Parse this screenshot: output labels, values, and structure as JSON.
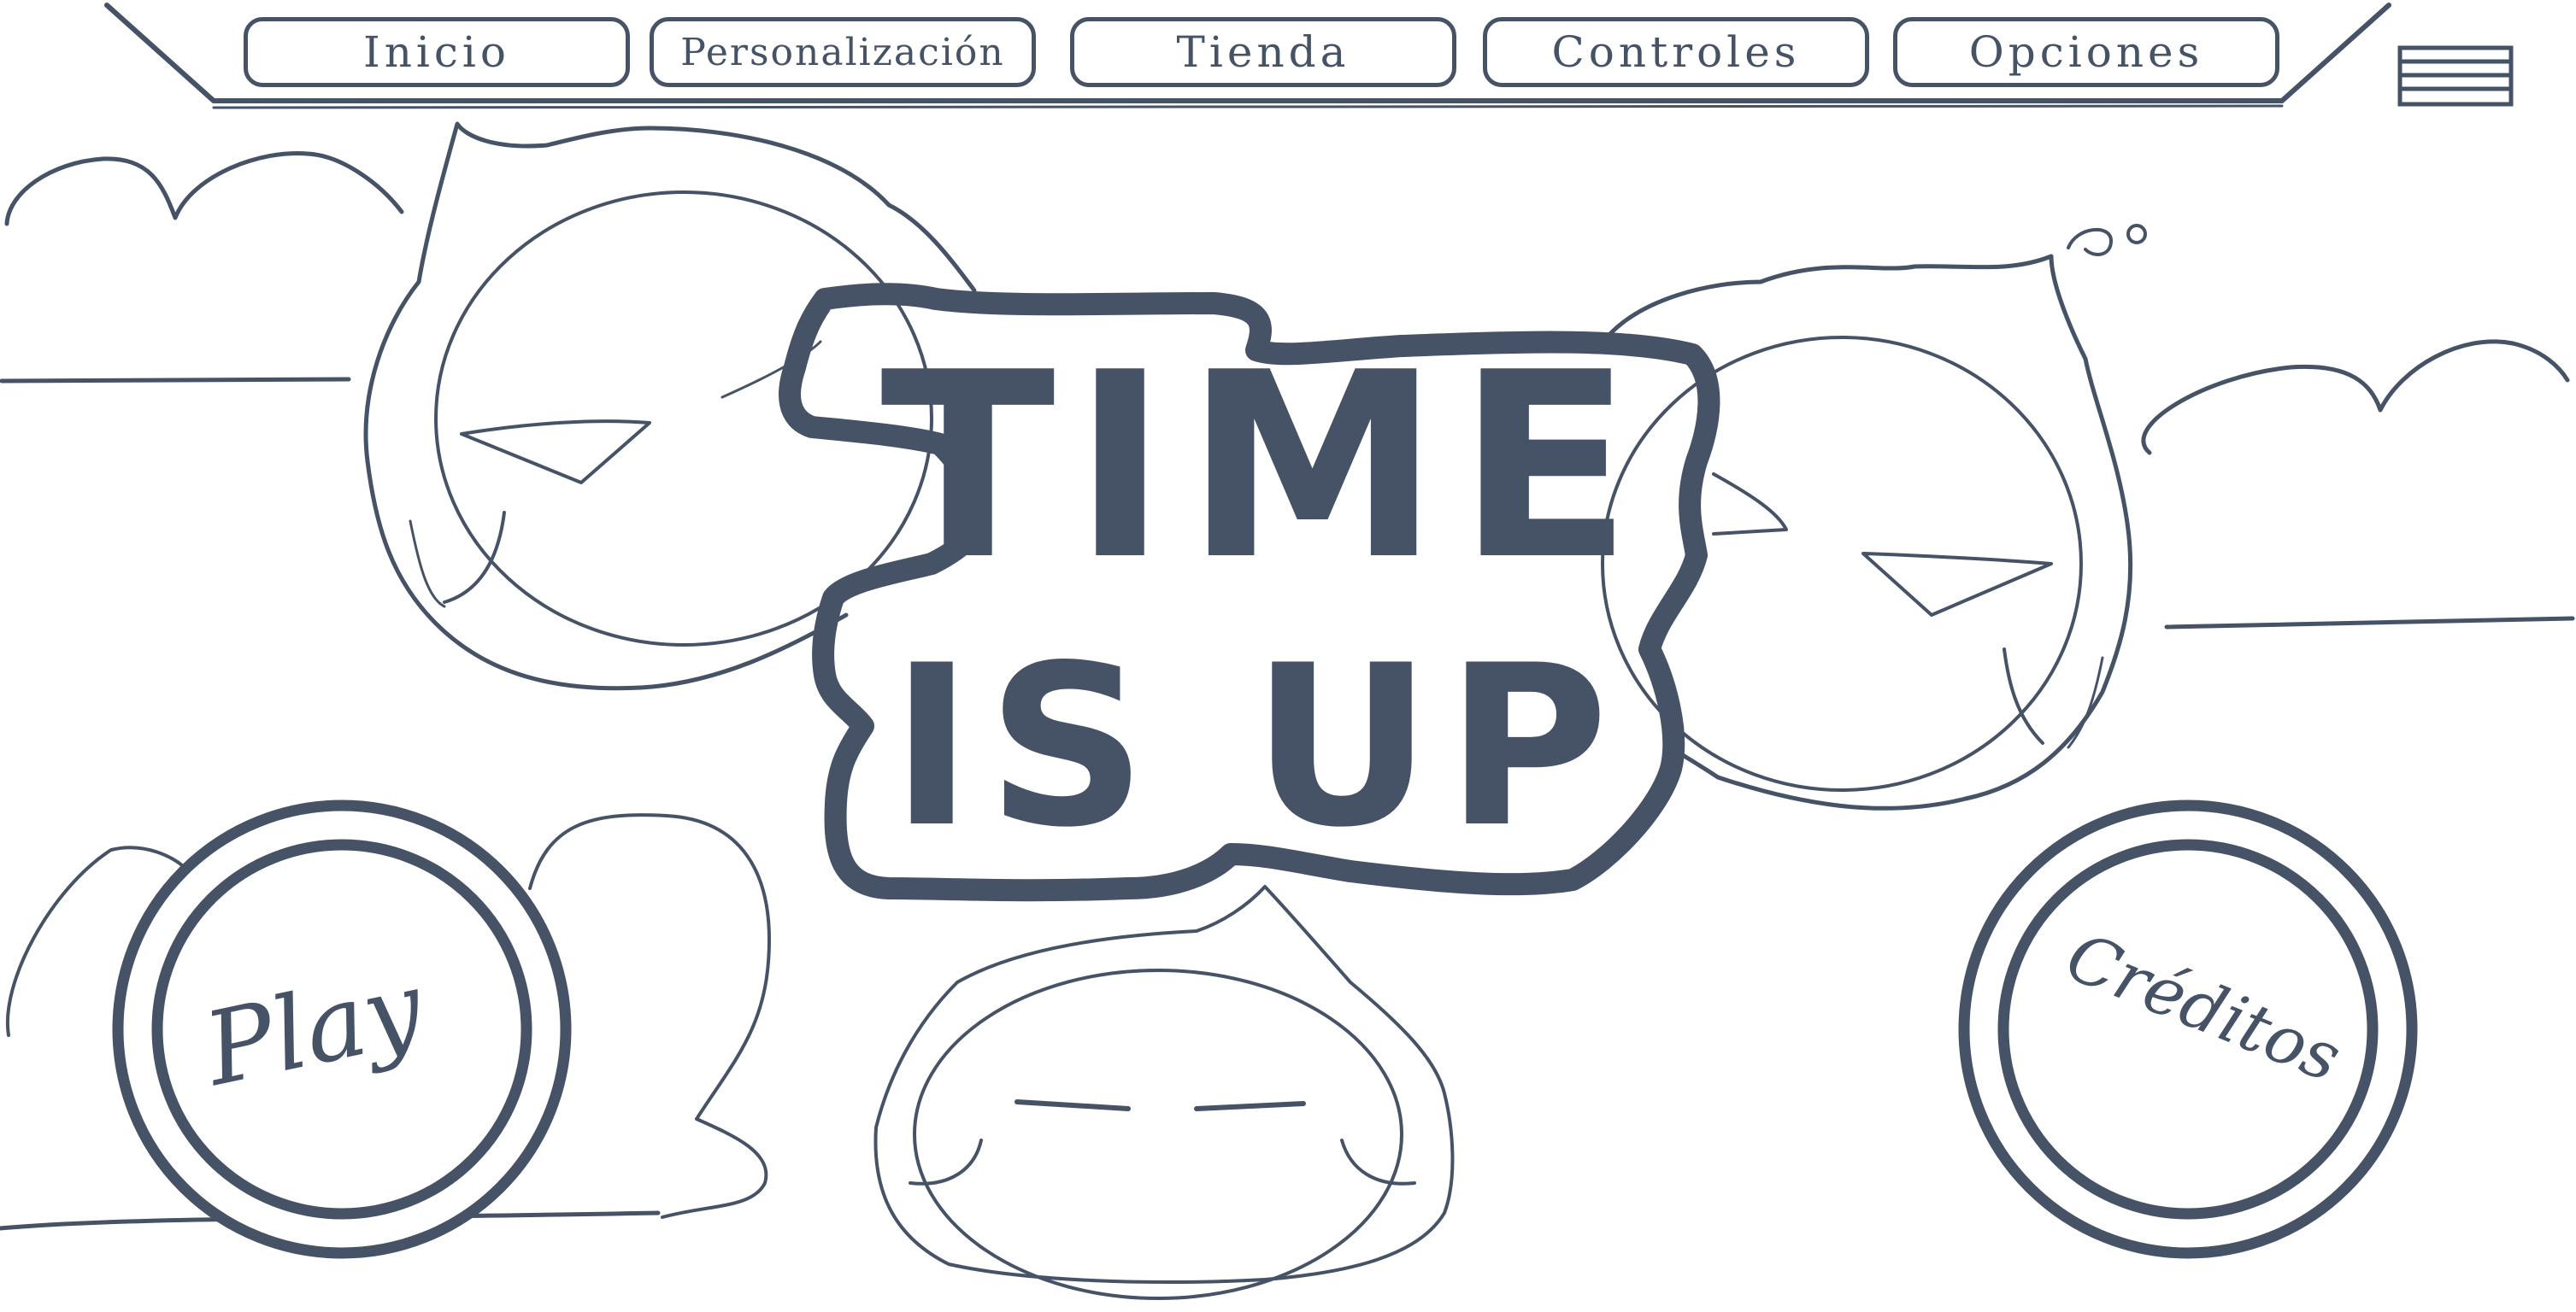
{
  "nav": {
    "tabs": [
      {
        "label": "Inicio"
      },
      {
        "label": "Personalización"
      },
      {
        "label": "Tienda"
      },
      {
        "label": "Controles"
      },
      {
        "label": "Opciones"
      }
    ]
  },
  "menu_icon": "hamburger-menu-icon",
  "title": {
    "line1": "TIME",
    "line2": "IS UP"
  },
  "buttons": {
    "play": "Play",
    "credits": "Créditos"
  },
  "colors": {
    "ink": "#465366",
    "background": "#ffffff"
  }
}
